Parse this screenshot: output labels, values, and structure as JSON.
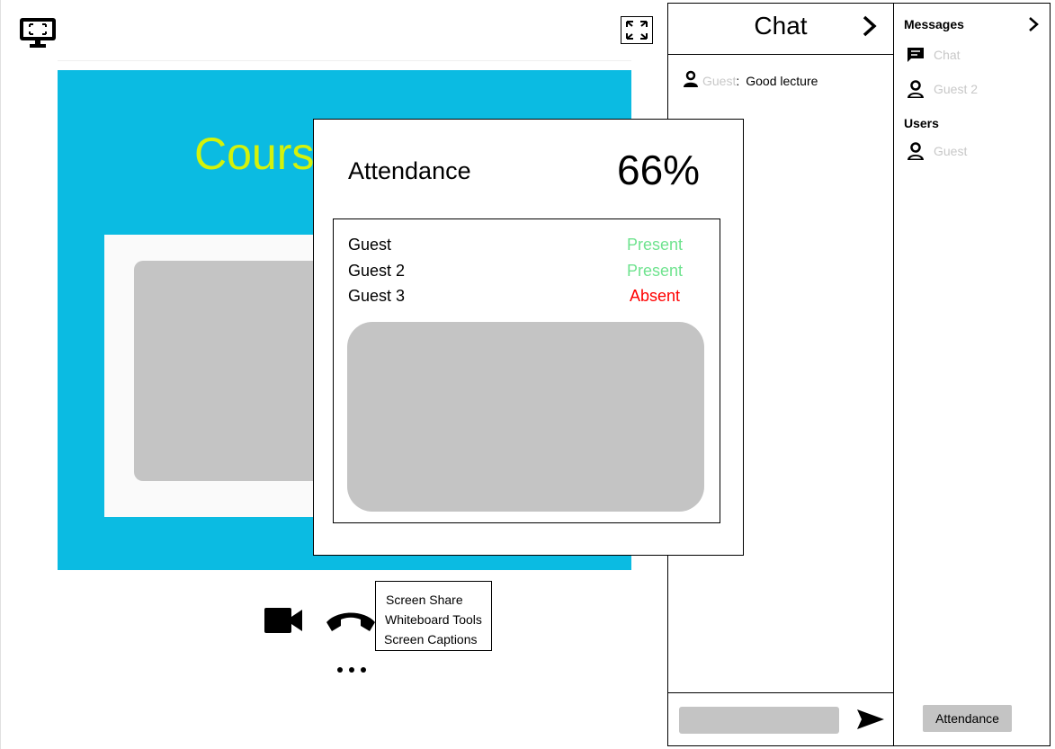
{
  "colors": {
    "slide_bg": "#0bbbe2",
    "slide_title": "#d4f20a",
    "present": "#6fe38f",
    "absent": "#ff0000",
    "muted_text": "#c8c8c8",
    "placeholder_gray": "#c4c4c4"
  },
  "slide": {
    "title": "Cours"
  },
  "icons": {
    "monitor": "monitor-icon",
    "fullscreen": "fullscreen-icon",
    "camera": "video-camera-icon",
    "phone": "end-call-icon",
    "more": "more-horizontal-icon",
    "chevron": "chevron-right-icon",
    "user": "user-icon",
    "chat": "chat-bubble-icon",
    "send": "send-icon"
  },
  "controls": {
    "more_label": "• • •",
    "menu": [
      "Screen Share",
      "Whiteboard Tools",
      "Screen Captions"
    ]
  },
  "chat": {
    "title": "Chat",
    "messages": [
      {
        "author": "Guest",
        "separator": ":",
        "text": "Good lecture"
      }
    ],
    "input_placeholder": ""
  },
  "sidebar": {
    "messages_heading": "Messages",
    "message_items": [
      "Chat",
      "Guest 2"
    ],
    "users_heading": "Users",
    "user_items": [
      "Guest"
    ],
    "attendance_button": "Attendance"
  },
  "attendance": {
    "title": "Attendance",
    "percent": "66%",
    "rows": [
      {
        "name": "Guest",
        "status": "Present"
      },
      {
        "name": "Guest 2",
        "status": "Present"
      },
      {
        "name": "Guest 3",
        "status": "Absent"
      }
    ]
  }
}
